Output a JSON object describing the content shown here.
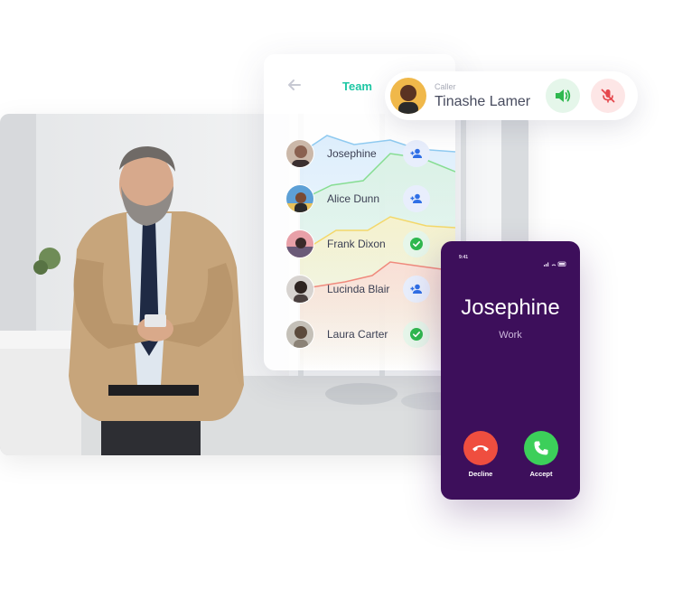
{
  "team_panel": {
    "title": "Team",
    "back_icon": "arrow-left-icon",
    "contacts": [
      {
        "name": "Josephine",
        "action": "add-user-icon",
        "status": "invite"
      },
      {
        "name": "Alice Dunn",
        "action": "add-user-icon",
        "status": "invite"
      },
      {
        "name": "Frank Dixon",
        "action": "check-circle-icon",
        "status": "added"
      },
      {
        "name": "Lucinda Blair",
        "action": "add-user-icon",
        "status": "invite"
      },
      {
        "name": "Laura Carter",
        "action": "check-circle-icon",
        "status": "added"
      }
    ]
  },
  "caller": {
    "label": "Caller",
    "name": "Tinashe Lamer",
    "speaker_icon": "speaker-icon",
    "mute_icon": "mic-off-icon"
  },
  "incoming_call": {
    "status_time": "9:41",
    "name": "Josephine",
    "subtitle": "Work",
    "decline_label": "Decline",
    "accept_label": "Accept",
    "decline_icon": "phone-hangup-icon",
    "accept_icon": "phone-icon"
  },
  "colors": {
    "accent_teal": "#1ec7a4",
    "phone_bg": "#3d0f5b",
    "decline": "#ef4e3f",
    "accept": "#3ccf5a",
    "add_blue": "#2f6fe6",
    "check_green": "#2fb84f"
  }
}
